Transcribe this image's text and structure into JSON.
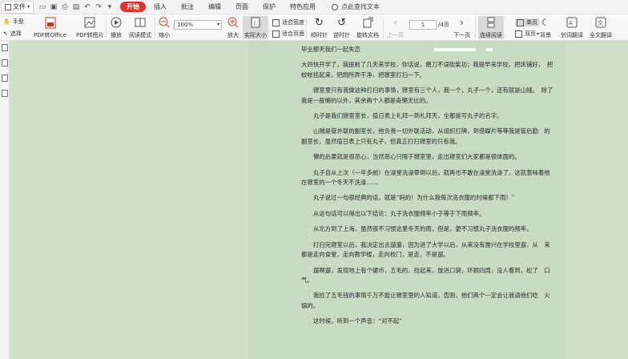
{
  "menubar": {
    "file_label": "文件",
    "tabs": [
      "开始",
      "插入",
      "批注",
      "编辑",
      "页面",
      "保护",
      "特色应用"
    ],
    "search_label": "点此查找文本"
  },
  "ribbon": {
    "hand_tool": "手型",
    "select_tool": "选择",
    "pdf_to_office": "PDF转Office",
    "pdf_to_image": "PDF转图片",
    "play": "播放",
    "read_mode": "阅读模式",
    "zoom_out": "缩小",
    "zoom_value": "100%",
    "zoom_in": "放大",
    "actual_size": "实际大小",
    "fit_width": "适合宽度",
    "fit_page": "适合页面",
    "rotate_cw": "顺时针",
    "rotate_ccw": "逆时针",
    "rotate_doc": "旋转文档",
    "prev_page": "上一页",
    "page_current": "1",
    "page_total": "/4页",
    "next_page": "下一页",
    "continuous": "连续阅读",
    "single_page": "单页",
    "double_page": "双页",
    "background": "背景",
    "word_translate": "划词翻译",
    "full_translate": "全文翻译"
  },
  "document": {
    "title": "毕业那天我们一起失恋",
    "paragraphs": [
      "大四快开学了，我提前了几天来学校，你话说，磨刀不误砍柴功；我提早来学校，把床铺好，　把蚊帐挂起来，把厕所弄干净，把寝室打扫一下。",
      "寝室里只有我做这种打扫的事情，寝室有三个人，我一个，丸子一个，还有就是山贼。　除了我是一般懒的以外，其余两个人都是奇懒无比的。",
      "丸子是我们寝室室长，值日表上礼拜一到礼拜天，全都是写丸子的名字。",
      "山贼是管外联的副室长，他负责一切外联活动，从组织打牌，到借碟片等等我是管后勤　的副室长，虽然值日表上只有丸子，但真正打扫寝室的只有我。",
      "懒的后果就是很恶心，当然恶心只限于寝室里，走出寝室们大家都是很体面的。",
      "丸子自从上次（一年多前）在澡堂洗澡晕倒以后，就再也不敢在澡堂洗澡了，这就意味着他在寝室的一个冬天不洗澡……",
      "丸子说过一句很经典的话，就是“妈的！为什么我每次洗衣服的时候都下雨！”",
      "从这句话可以得出以下结论：丸子洗衣服频率小于等于下雨频率。",
      "从北方到了上海，虽然很不习惯这里冬天的雨，但是，更不习惯丸子洗衣服的频率。",
      "打扫完寝室以后，我决定出去遛遛，因为进了大学以后，从来没有雅兴在学校里遛，从　来都是走向食堂，走向教学楼，走向校门，是走，不是遛。",
      "遛啊遛，发现地上有个硬币，五毛的，捡起来，放进口袋，环顾四周，没人看到，松了　口气。",
      "我捡了五毛钱的事情千万不能让寝室里的人知道，否则，他们两个一定会让我请他们吃　火锅的。",
      "这时候，听到一个声音：“对不起”"
    ]
  }
}
